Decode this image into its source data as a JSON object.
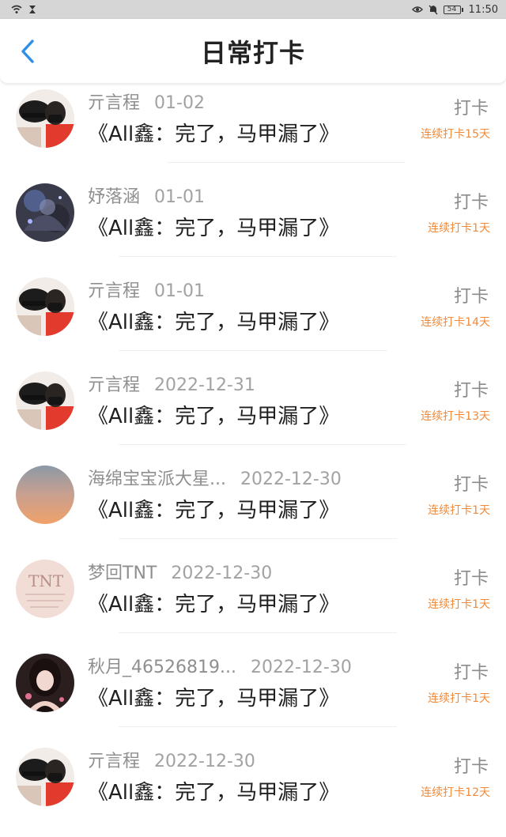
{
  "status_bar": {
    "time": "11:50",
    "battery": "54",
    "icons": [
      "wifi-icon",
      "hourglass-icon",
      "eye-icon",
      "mute-icon",
      "battery-icon"
    ]
  },
  "header": {
    "title": "日常打卡",
    "back_icon": "chevron-left-icon"
  },
  "theme": {
    "accent": "#2e8fe6",
    "streak_color": "#f08a3a",
    "meta_color": "#8f8f8f"
  },
  "records": [
    {
      "username": "亓言程",
      "date": "01-02",
      "content": "《All鑫：完了，马甲漏了》",
      "action": "打卡",
      "streak": "连续打卡15天"
    },
    {
      "username": "妤落涵",
      "date": "01-01",
      "content": "《All鑫：完了，马甲漏了》",
      "action": "打卡",
      "streak": "连续打卡1天"
    },
    {
      "username": "亓言程",
      "date": "01-01",
      "content": "《All鑫：完了，马甲漏了》",
      "action": "打卡",
      "streak": "连续打卡14天"
    },
    {
      "username": "亓言程",
      "date": "2022-12-31",
      "content": "《All鑫：完了，马甲漏了》",
      "action": "打卡",
      "streak": "连续打卡13天"
    },
    {
      "username": "海绵宝宝派大星...",
      "date": "2022-12-30",
      "content": "《All鑫：完了，马甲漏了》",
      "action": "打卡",
      "streak": "连续打卡1天"
    },
    {
      "username": "梦回TNT",
      "date": "2022-12-30",
      "content": "《All鑫：完了，马甲漏了》",
      "action": "打卡",
      "streak": "连续打卡1天"
    },
    {
      "username": "秋月_46526819...",
      "date": "2022-12-30",
      "content": "《All鑫：完了，马甲漏了》",
      "action": "打卡",
      "streak": "连续打卡1天"
    },
    {
      "username": "亓言程",
      "date": "2022-12-30",
      "content": "《All鑫：完了，马甲漏了》",
      "action": "打卡",
      "streak": "连续打卡12天"
    }
  ]
}
